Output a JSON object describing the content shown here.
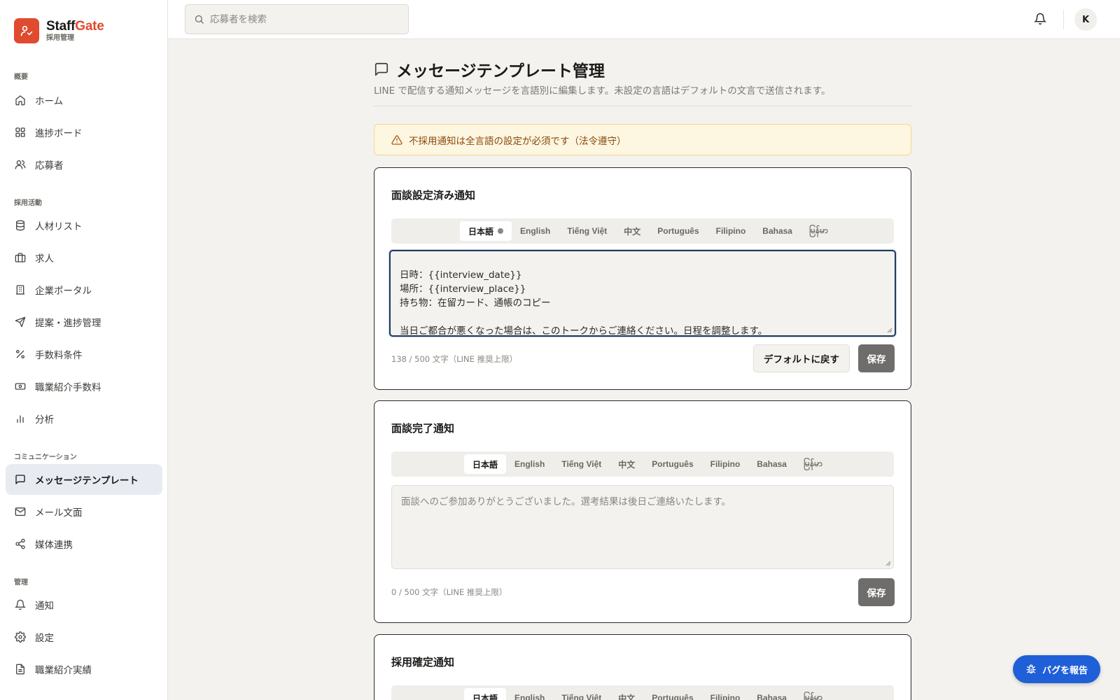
{
  "brand": {
    "name_part1": "Staff",
    "name_part2": "Gate",
    "subtitle": "採用管理"
  },
  "sidebar": {
    "sections": [
      {
        "label": "概要"
      },
      {
        "label": "採用活動"
      },
      {
        "label": "コミュニケーション"
      },
      {
        "label": "管理"
      }
    ],
    "items": [
      {
        "label": "ホーム",
        "icon": "home-icon"
      },
      {
        "label": "進捗ボード",
        "icon": "grid-icon"
      },
      {
        "label": "応募者",
        "icon": "users-icon"
      },
      {
        "label": "人材リスト",
        "icon": "database-icon"
      },
      {
        "label": "求人",
        "icon": "briefcase-icon"
      },
      {
        "label": "企業ポータル",
        "icon": "building-icon"
      },
      {
        "label": "提案・進捗管理",
        "icon": "send-icon"
      },
      {
        "label": "手数料条件",
        "icon": "percent-icon"
      },
      {
        "label": "職業紹介手数料",
        "icon": "banknote-icon"
      },
      {
        "label": "分析",
        "icon": "chart-icon"
      },
      {
        "label": "メッセージテンプレート",
        "icon": "message-icon",
        "active": true
      },
      {
        "label": "メール文面",
        "icon": "mail-icon"
      },
      {
        "label": "媒体連携",
        "icon": "share-icon"
      },
      {
        "label": "通知",
        "icon": "bell-icon"
      },
      {
        "label": "設定",
        "icon": "gear-icon"
      },
      {
        "label": "職業紹介実績",
        "icon": "file-icon"
      }
    ]
  },
  "header": {
    "search_placeholder": "応募者を検索",
    "avatar_initial": "K"
  },
  "main": {
    "title": "メッセージテンプレート管理",
    "description": "LINE で配信する通知メッセージを言語別に編集します。未設定の言語はデフォルトの文言で送信されます。",
    "alert": "不採用通知は全言語の設定が必須です（法令遵守）",
    "languages": [
      "日本語",
      "English",
      "Tiếng Việt",
      "中文",
      "Português",
      "Filipino",
      "Bahasa",
      "မြန်မာ"
    ],
    "cards": [
      {
        "title": "面談設定済み通知",
        "active_language": "日本語",
        "has_indicator": true,
        "lines": [
          "",
          "日時：{{interview_date}}",
          "場所：{{interview_place}}",
          "持ち物：在留カード、通帳のコピー",
          "",
          "当日ご都合が悪くなった場合は、このトークからご連絡ください。日程を調整します。"
        ],
        "counter": "138 / 500 文字（LINE 推奨上限）",
        "reset_label": "デフォルトに戻す",
        "save_label": "保存"
      },
      {
        "title": "面談完了通知",
        "active_language": "日本語",
        "placeholder": "面談へのご参加ありがとうございました。選考結果は後日ご連絡いたします。",
        "counter": "0 / 500 文字（LINE 推奨上限）",
        "save_label": "保存"
      },
      {
        "title": "採用確定通知",
        "active_language": "日本語"
      }
    ]
  },
  "bug_button": {
    "label": "バグを報告"
  },
  "colors": {
    "brand": "#e04a2f",
    "active_nav_bg": "#e8ebf2",
    "alert_bg": "#fdf6e0",
    "bug_button": "#1f5fd8"
  }
}
